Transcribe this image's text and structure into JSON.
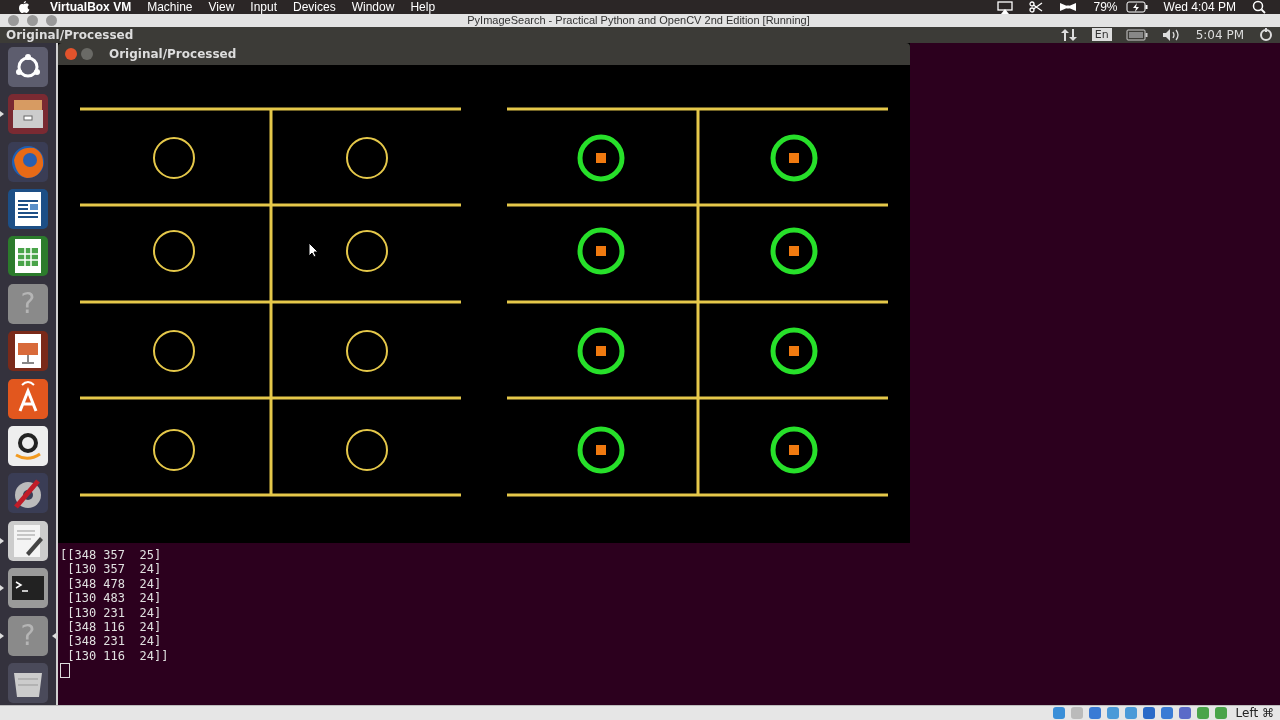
{
  "mac_menu_bar": {
    "app": "VirtualBox VM",
    "menus": [
      "Machine",
      "View",
      "Input",
      "Devices",
      "Window",
      "Help"
    ],
    "battery": "79%",
    "clock": "Wed 4:04 PM"
  },
  "vm_window": {
    "title": "PyImageSearch - Practical Python and OpenCV 2nd Edition [Running]"
  },
  "ubuntu_panel": {
    "title": "Original/Processed",
    "keyboard": "En",
    "clock": "5:04 PM"
  },
  "launcher": [
    {
      "kind": "dash",
      "running": false,
      "focused": false
    },
    {
      "kind": "files",
      "running": true,
      "focused": false
    },
    {
      "kind": "browser",
      "running": false,
      "focused": false
    },
    {
      "kind": "writer",
      "running": false,
      "focused": false
    },
    {
      "kind": "calc",
      "running": false,
      "focused": false
    },
    {
      "kind": "unknown",
      "glyph": "?",
      "running": false,
      "focused": false
    },
    {
      "kind": "impress",
      "running": false,
      "focused": false
    },
    {
      "kind": "store",
      "running": false,
      "focused": false
    },
    {
      "kind": "amazon",
      "running": false,
      "focused": false
    },
    {
      "kind": "settings",
      "running": false,
      "focused": false
    },
    {
      "kind": "editor",
      "running": true,
      "focused": false
    },
    {
      "kind": "terminal",
      "running": true,
      "focused": false
    },
    {
      "kind": "unknown",
      "glyph": "?",
      "running": true,
      "focused": true
    },
    {
      "kind": "trash",
      "running": false,
      "focused": false
    }
  ],
  "image_window": {
    "title": "Original/Processed",
    "panels": [
      {
        "cells": [
          {
            "marked": false
          },
          {
            "marked": false
          },
          {
            "marked": false
          },
          {
            "marked": false
          },
          {
            "marked": false
          },
          {
            "marked": false
          },
          {
            "marked": false
          },
          {
            "marked": false
          }
        ]
      },
      {
        "cells": [
          {
            "marked": true
          },
          {
            "marked": true
          },
          {
            "marked": true
          },
          {
            "marked": true
          },
          {
            "marked": true
          },
          {
            "marked": true
          },
          {
            "marked": true
          },
          {
            "marked": true
          }
        ]
      }
    ]
  },
  "terminal": {
    "lines": [
      "[[348 357  25]",
      " [130 357  24]",
      " [348 478  24]",
      " [130 483  24]",
      " [130 231  24]",
      " [348 116  24]",
      " [348 231  24]",
      " [130 116  24]]"
    ]
  },
  "status_bar": {
    "host_key": "Left ⌘"
  }
}
